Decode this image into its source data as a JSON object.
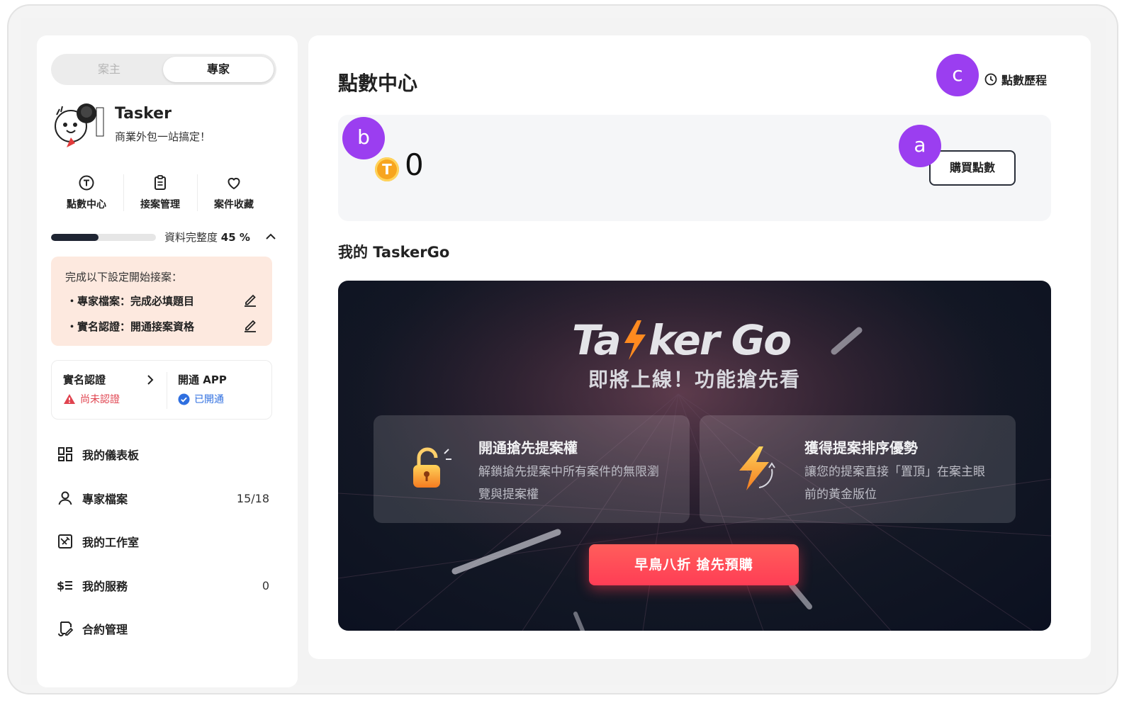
{
  "toggle": {
    "client": "案主",
    "expert": "專家"
  },
  "profile": {
    "name": "Tasker",
    "tagline": "商業外包一站搞定！"
  },
  "quick_links": [
    {
      "label": "點數中心",
      "icon": "coin-t-icon"
    },
    {
      "label": "接案管理",
      "icon": "clipboard-icon"
    },
    {
      "label": "案件收藏",
      "icon": "heart-icon"
    }
  ],
  "profile_progress": {
    "label": "資料完整度",
    "percent_text": "45 %",
    "value": 0.45
  },
  "todo": {
    "title": "完成以下設定開始接案：",
    "items": [
      "・專家檔案：完成必填題目",
      "・實名認證：開通接案資格"
    ]
  },
  "verification": {
    "identity": {
      "title": "實名認證",
      "status": "尚未認證"
    },
    "app": {
      "title": "開通 APP",
      "status": "已開通"
    }
  },
  "menu": [
    {
      "label": "我的儀表板",
      "icon": "dashboard-icon",
      "count": ""
    },
    {
      "label": "專家檔案",
      "icon": "user-icon",
      "count": "15/18"
    },
    {
      "label": "我的工作室",
      "icon": "studio-icon",
      "count": ""
    },
    {
      "label": "我的服務",
      "icon": "services-icon",
      "count": "0"
    },
    {
      "label": "合約管理",
      "icon": "contract-icon",
      "count": ""
    }
  ],
  "main": {
    "title": "點數中心",
    "history_label": "點數歷程",
    "points": {
      "coin_letter": "T",
      "value": "0"
    },
    "buy_label": "購買點數",
    "section_title": "我的 TaskerGo"
  },
  "promo": {
    "logo_text": "TaskerGo",
    "subtitle": "即將上線！功能搶先看",
    "features": [
      {
        "title": "開通搶先提案權",
        "desc": "解鎖搶先提案中所有案件的無限瀏覽與提案權",
        "icon": "unlock-icon"
      },
      {
        "title": "獲得提案排序優勢",
        "desc": "讓您的提案直接「置頂」在案主眼前的黃金版位",
        "icon": "lightning-icon"
      }
    ],
    "cta": "早鳥八折  搶先預購"
  },
  "markers": {
    "a": "a",
    "b": "b",
    "c": "c"
  },
  "colors": {
    "marker": "#9b3ef0",
    "cta": "#ff4757",
    "progress": "#1f2533",
    "warn": "#e0434f",
    "ok": "#2f6fe0"
  }
}
